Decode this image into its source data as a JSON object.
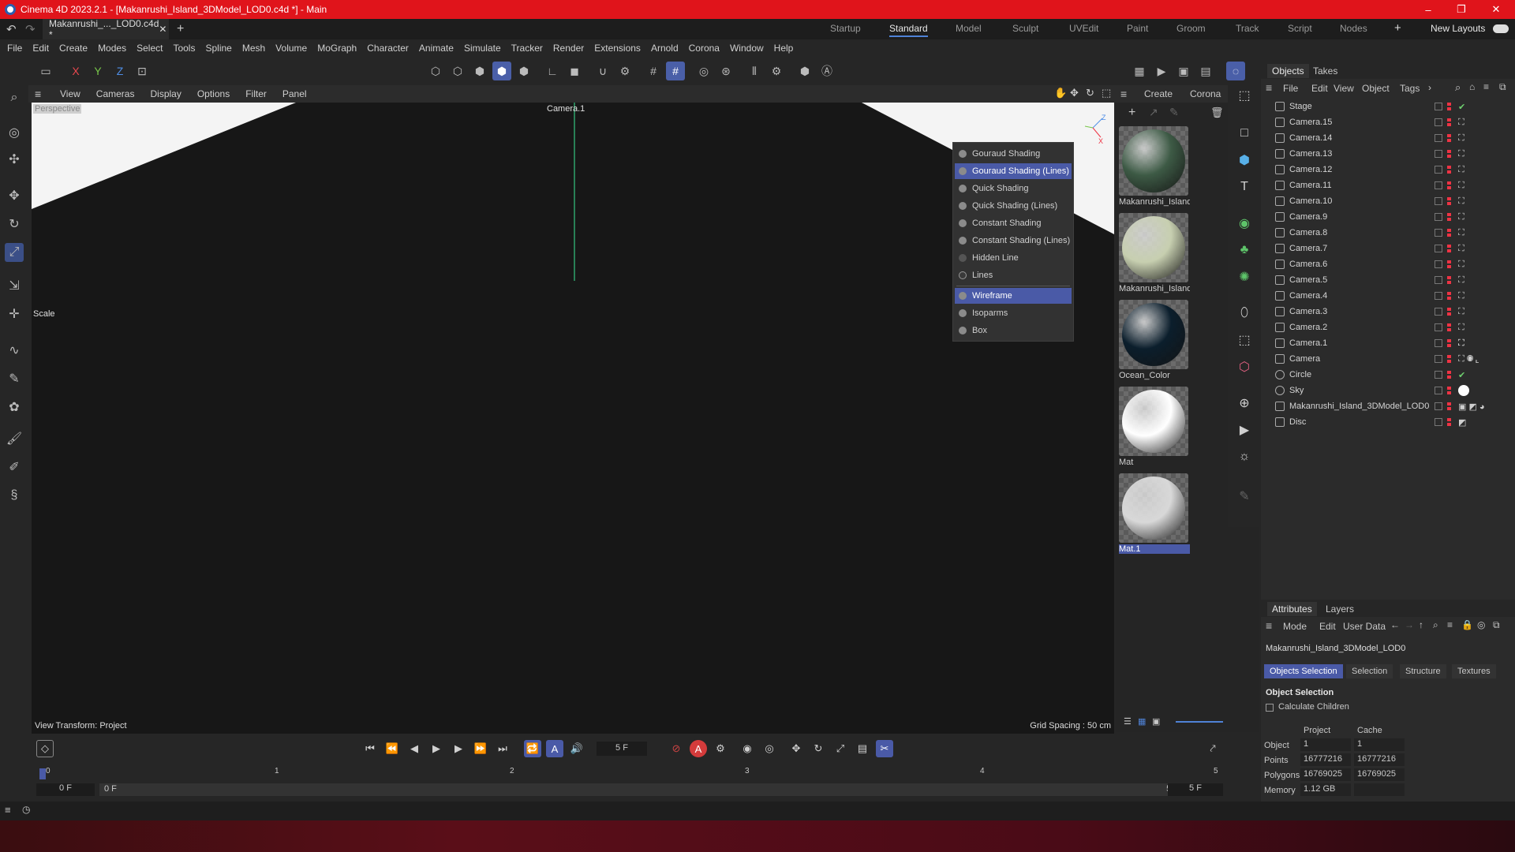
{
  "window": {
    "title": "Cinema 4D 2023.2.1 - [Makanrushi_Island_3DModel_LOD0.c4d *] - Main",
    "controls": [
      "–",
      "❐",
      "✕"
    ]
  },
  "tabs": {
    "doc_tab": "Makanrushi_..._LOD0.c4d *",
    "close": "✕",
    "add": "+"
  },
  "layouts": {
    "items": [
      "Startup",
      "Standard",
      "Model",
      "Sculpt",
      "UVEdit",
      "Paint",
      "Groom",
      "Track",
      "Script",
      "Nodes"
    ],
    "active": "Standard",
    "add": "+",
    "new_layouts": "New Layouts"
  },
  "menu": [
    "File",
    "Edit",
    "Create",
    "Modes",
    "Select",
    "Tools",
    "Spline",
    "Mesh",
    "Volume",
    "MoGraph",
    "Character",
    "Animate",
    "Simulate",
    "Tracker",
    "Render",
    "Extensions",
    "Arnold",
    "Corona",
    "Window",
    "Help"
  ],
  "toolbar": {
    "x": "X",
    "y": "Y",
    "z": "Z"
  },
  "viewport": {
    "menu": [
      "View",
      "Cameras",
      "Display",
      "Options",
      "Filter",
      "Panel"
    ],
    "label": "Perspective",
    "camera": "Camera.1",
    "tool_label": "Scale",
    "view_transform": "View Transform: Project",
    "grid_spacing": "Grid Spacing : 50 cm",
    "axis": {
      "z": "Z",
      "x": "X"
    }
  },
  "shading_menu": {
    "items": [
      "Gouraud Shading",
      "Gouraud Shading (Lines)",
      "Quick Shading",
      "Quick Shading (Lines)",
      "Constant Shading",
      "Constant Shading (Lines)",
      "Hidden Line",
      "Lines",
      "Wireframe",
      "Isoparms",
      "Box"
    ],
    "highlighted": [
      "Gouraud Shading (Lines)",
      "Wireframe"
    ]
  },
  "materials": {
    "menu": [
      "Create",
      "Corona"
    ],
    "items": [
      {
        "name": "Makanrushi_Island",
        "color": "#3d5a45"
      },
      {
        "name": "Makanrushi_Island",
        "color": "#c7cfb0"
      },
      {
        "name": "Ocean_Color",
        "color": "#0b1e2c"
      },
      {
        "name": "Mat",
        "color": "#ffffff"
      },
      {
        "name": "Mat.1",
        "color": "#d8d8d8"
      }
    ],
    "selected": "Mat.1"
  },
  "objects": {
    "tabs": [
      "Objects",
      "Takes"
    ],
    "menu": [
      "File",
      "Edit",
      "View",
      "Object",
      "Tags"
    ],
    "rows": [
      "Stage",
      "Camera.15",
      "Camera.14",
      "Camera.13",
      "Camera.12",
      "Camera.11",
      "Camera.10",
      "Camera.9",
      "Camera.8",
      "Camera.7",
      "Camera.6",
      "Camera.5",
      "Camera.4",
      "Camera.3",
      "Camera.2",
      "Camera.1",
      "Camera",
      "Circle",
      "Sky",
      "Makanrushi_Island_3DModel_LOD0",
      "Disc"
    ]
  },
  "attributes": {
    "tabs": [
      "Attributes",
      "Layers"
    ],
    "menu": [
      "Mode",
      "Edit",
      "User Data"
    ],
    "object_name": "Makanrushi_Island_3DModel_LOD0",
    "subtabs": [
      "Objects Selection",
      "Selection",
      "Structure",
      "Textures"
    ],
    "section": "Object Selection",
    "calc_children": "Calculate Children",
    "columns": [
      "Project",
      "Cache"
    ],
    "rows": [
      {
        "label": "Object",
        "project": "1",
        "cache": "1"
      },
      {
        "label": "Points",
        "project": "16777216",
        "cache": "16777216"
      },
      {
        "label": "Polygons",
        "project": "16769025",
        "cache": "16769025"
      },
      {
        "label": "Memory",
        "project": "1.12 GB",
        "cache": ""
      }
    ]
  },
  "timeline": {
    "current_frame": "5 F",
    "ruler": [
      "0",
      "1",
      "2",
      "3",
      "4",
      "5"
    ],
    "start": "0 F",
    "start2": "0 F",
    "end": "5 F",
    "end2": "5 F"
  }
}
